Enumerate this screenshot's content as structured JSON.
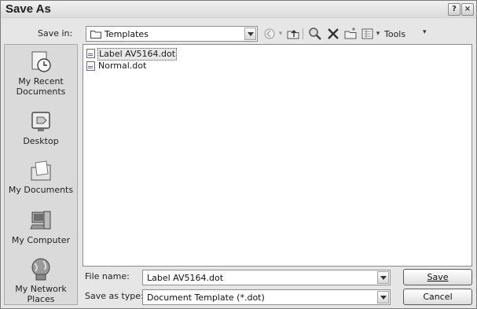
{
  "window": {
    "title": "Save As",
    "help_glyph": "?",
    "close_glyph": "×"
  },
  "toolbar": {
    "save_in_label": "Save in:",
    "save_in_value": "Templates",
    "tools_label": "Tools",
    "icons": [
      "back-icon",
      "up-one-level-icon",
      "search-web-icon",
      "delete-icon",
      "new-folder-icon",
      "views-icon"
    ]
  },
  "places": [
    {
      "label": "My Recent Documents",
      "icon": "recent-documents-icon"
    },
    {
      "label": "Desktop",
      "icon": "desktop-icon"
    },
    {
      "label": "My Documents",
      "icon": "my-documents-icon"
    },
    {
      "label": "My Computer",
      "icon": "my-computer-icon"
    },
    {
      "label": "My Network Places",
      "icon": "network-places-icon"
    }
  ],
  "files": [
    {
      "name": "Label AV5164.dot",
      "selected": true
    },
    {
      "name": "Normal.dot",
      "selected": false
    }
  ],
  "form": {
    "file_name_label": "File name:",
    "file_name_value": "Label AV5164.dot",
    "save_as_type_label": "Save as type:",
    "save_as_type_value": "Document Template (*.dot)"
  },
  "buttons": {
    "save": "Save",
    "cancel": "Cancel"
  }
}
